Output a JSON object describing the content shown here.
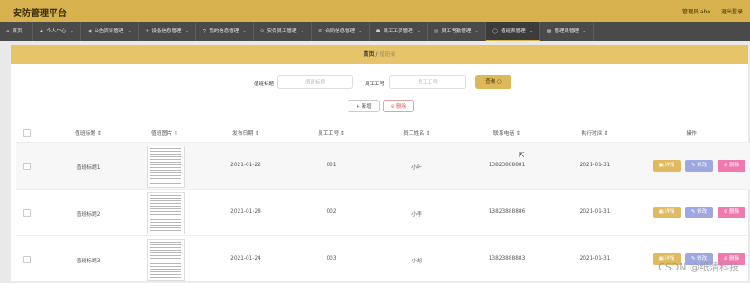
{
  "app": {
    "title": "安防管理平台",
    "user": "管理员 abo",
    "logout": "退出登录"
  },
  "nav": [
    {
      "label": "首页",
      "icon": "⌂",
      "chevron": ""
    },
    {
      "label": "个人中心",
      "icon": "♟",
      "chevron": "⌄"
    },
    {
      "label": "公告资讯管理",
      "icon": "◀",
      "chevron": "⌄"
    },
    {
      "label": "设备信息管理",
      "icon": "✈",
      "chevron": "⌄"
    },
    {
      "label": "我的信息管理",
      "icon": "⚲",
      "chevron": "⌄"
    },
    {
      "label": "安保员工管理",
      "icon": "⊙",
      "chevron": "⌄"
    },
    {
      "label": "合同信息管理",
      "icon": "☰",
      "chevron": "⌄"
    },
    {
      "label": "员工工资管理",
      "icon": "☗",
      "chevron": "⌄"
    },
    {
      "label": "员工考勤管理",
      "icon": "▤",
      "chevron": "⌄"
    },
    {
      "label": "值班表管理",
      "icon": "◯",
      "chevron": "⌄"
    },
    {
      "label": "管理员管理",
      "icon": "▦",
      "chevron": "⌄"
    }
  ],
  "breadcrumb": {
    "home": "首页",
    "sep": "/",
    "current": "值班表"
  },
  "search": {
    "title_label": "值班标题",
    "title_placeholder": "值班标题",
    "emp_label": "员工工号",
    "emp_placeholder": "员工工号",
    "query_label": "查询 ○"
  },
  "actions": {
    "add": "+ 新增",
    "delete": "⊘ 删除"
  },
  "table": {
    "columns": [
      "值班标题 ⇕",
      "值班图片 ⇕",
      "发布日期 ⇕",
      "员工工号 ⇕",
      "员工姓名 ⇕",
      "联系电话 ⇕",
      "执行时间 ⇕",
      "操作"
    ],
    "rows": [
      {
        "title": "值班标题1",
        "date": "2021-01-22",
        "emp_no": "001",
        "name": "小叶",
        "phone": "13823888881",
        "exec": "2021-01-31"
      },
      {
        "title": "值班标题2",
        "date": "2021-01-28",
        "emp_no": "002",
        "name": "小李",
        "phone": "13823888886",
        "exec": "2021-01-31"
      },
      {
        "title": "值班标题3",
        "date": "2021-01-24",
        "emp_no": "003",
        "name": "小胡",
        "phone": "13823888883",
        "exec": "2021-01-31"
      }
    ],
    "row_actions": {
      "detail": "详情",
      "edit": "修改",
      "delete": "删除",
      "detail_icon": "▣",
      "edit_icon": "✎",
      "delete_icon": "⊘"
    }
  },
  "watermark": "CSDN @纸清科技",
  "colors": {
    "accent": "#d6b14d",
    "nav_bg": "#4a4a4a",
    "detail": "#e0b960",
    "edit": "#9fa7e0",
    "delete": "#f07ab0"
  }
}
